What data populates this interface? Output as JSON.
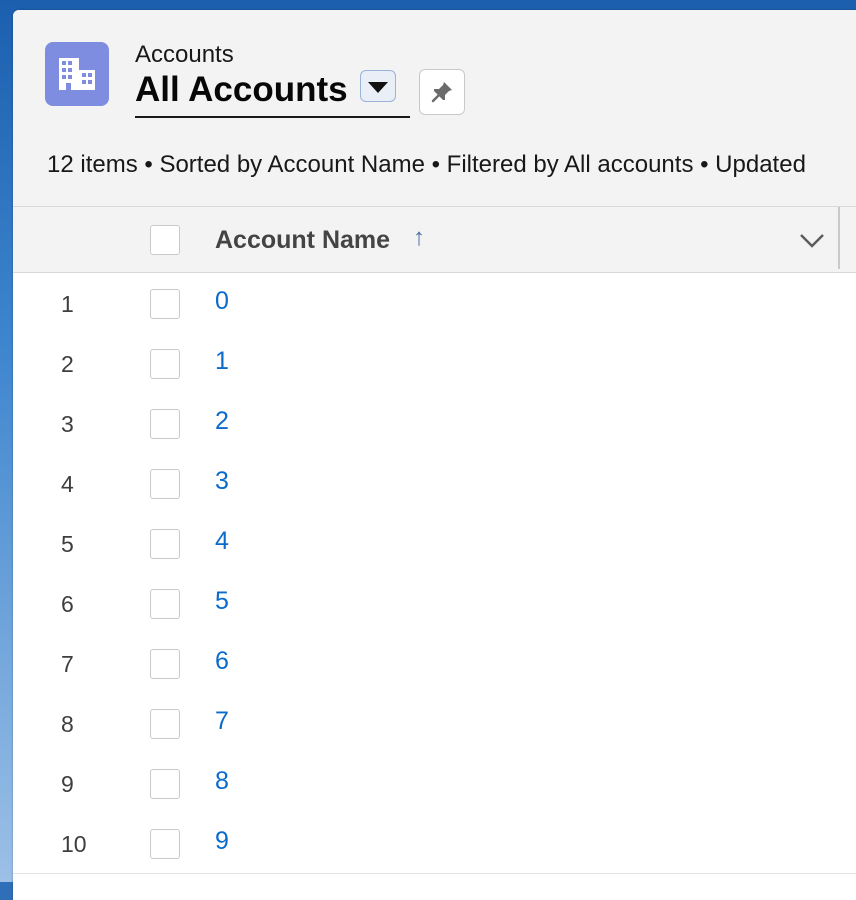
{
  "header": {
    "object_label": "Accounts",
    "list_view_title": "All Accounts",
    "info_line": "12 items • Sorted by Account Name • Filtered by All accounts • Updated"
  },
  "table": {
    "columns": [
      {
        "label": "Account Name",
        "sort": "ascending"
      }
    ],
    "rows": [
      {
        "num": "1",
        "name": "0"
      },
      {
        "num": "2",
        "name": "1"
      },
      {
        "num": "3",
        "name": "2"
      },
      {
        "num": "4",
        "name": "3"
      },
      {
        "num": "5",
        "name": "4"
      },
      {
        "num": "6",
        "name": "5"
      },
      {
        "num": "7",
        "name": "6"
      },
      {
        "num": "8",
        "name": "7"
      },
      {
        "num": "9",
        "name": "8"
      },
      {
        "num": "10",
        "name": "9"
      }
    ]
  },
  "icons": {
    "object": "building-icon",
    "dropdown": "caret-down-icon",
    "pin": "pin-icon",
    "sort": "arrow-up-icon",
    "column_menu": "chevron-down-icon"
  },
  "colors": {
    "object_icon_bg": "#7f8de1",
    "link": "#0b6bcb",
    "sort_arrow": "#4d6fa4"
  }
}
